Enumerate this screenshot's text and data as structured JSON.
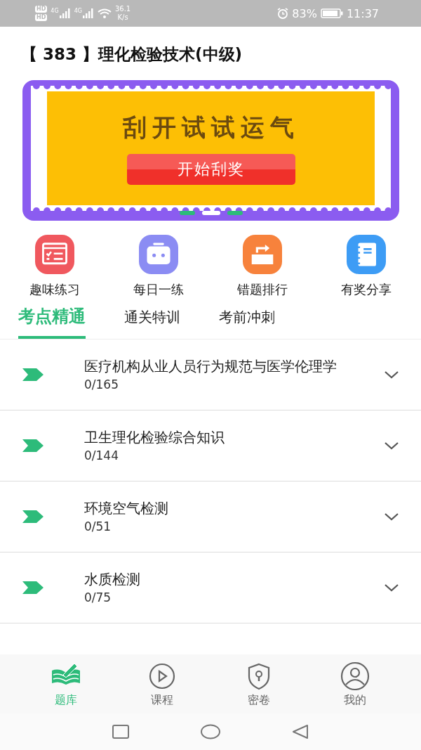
{
  "status_bar": {
    "hd_badges": [
      "HD",
      "HD"
    ],
    "signals": [
      {
        "network": "4G"
      },
      {
        "network": "4G"
      }
    ],
    "speed": "36.1",
    "speed_unit": "K/s",
    "battery": "83%",
    "time": "11:37"
  },
  "title": "【 383 】理化检验技术(中级)",
  "banner": {
    "headline": "刮开试试运气",
    "button": "开始刮奖",
    "pages": [
      {
        "selected": false
      },
      {
        "selected": true
      },
      {
        "selected": false
      }
    ]
  },
  "shortcuts": [
    {
      "kind": "practice",
      "label": "趣味练习"
    },
    {
      "kind": "daily",
      "label": "每日一练"
    },
    {
      "kind": "mistakes",
      "label": "错题排行"
    },
    {
      "kind": "share",
      "label": "有奖分享"
    }
  ],
  "tabs": [
    {
      "label": "考点精通",
      "selected": true
    },
    {
      "label": "通关特训",
      "selected": false
    },
    {
      "label": "考前冲刺",
      "selected": false
    }
  ],
  "chapters": [
    {
      "title": "医疗机构从业人员行为规范与医学伦理学",
      "progress": "0/165",
      "expanded": false
    },
    {
      "title": "卫生理化检验综合知识",
      "progress": "0/144",
      "expanded": false
    },
    {
      "title": "环境空气检测",
      "progress": "0/51",
      "expanded": false
    },
    {
      "title": "水质检测",
      "progress": "0/75",
      "expanded": false
    }
  ],
  "bottom_nav": [
    {
      "kind": "bank",
      "label": "题库",
      "selected": true
    },
    {
      "kind": "course",
      "label": "课程",
      "selected": false
    },
    {
      "kind": "secret",
      "label": "密卷",
      "selected": false
    },
    {
      "kind": "me",
      "label": "我的",
      "selected": false
    }
  ]
}
